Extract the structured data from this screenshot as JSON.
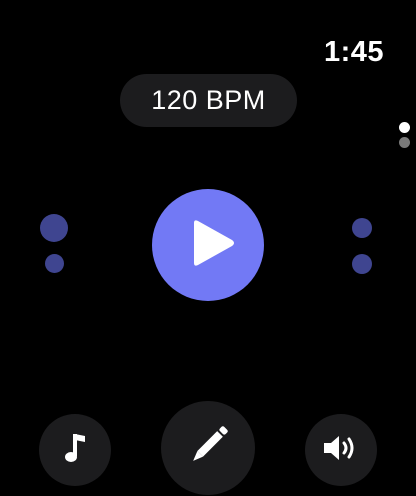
{
  "status": {
    "time": "1:45"
  },
  "tempo": {
    "label": "120 BPM"
  },
  "colors": {
    "accent": "#7279f5",
    "beat_dot": "#3f4590",
    "button_bg": "#1c1c1e",
    "page_dot_active": "#ffffff",
    "page_dot_inactive": "#7a7a7a"
  },
  "pages": {
    "current": 1,
    "total": 2
  },
  "icons": {
    "play": "play-icon",
    "music": "music-note-icon",
    "edit": "pencil-icon",
    "sound": "speaker-icon"
  }
}
